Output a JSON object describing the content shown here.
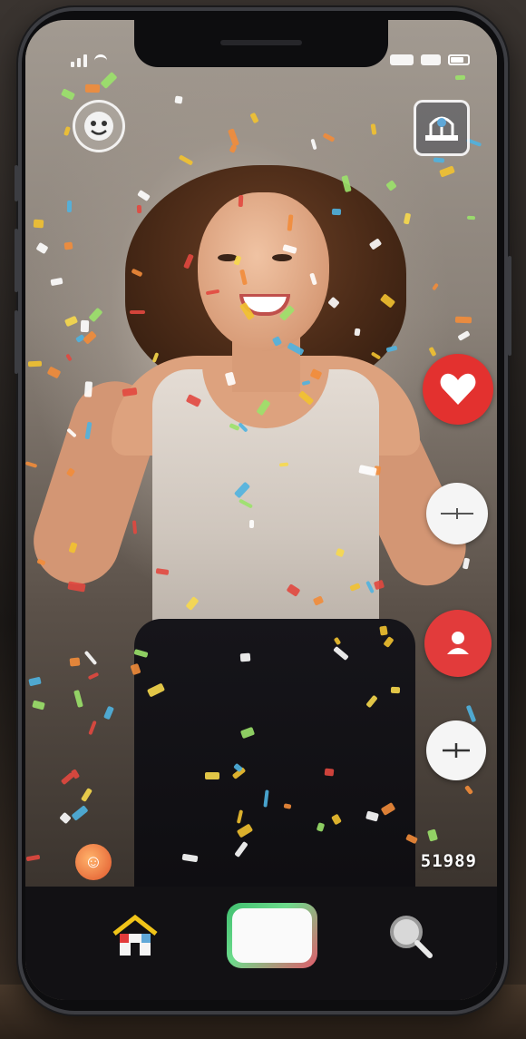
{
  "status_bar": {
    "signal_icon": "signal-icon",
    "wifi_icon": "wifi-icon",
    "battery_icon": "battery-icon"
  },
  "top_bar": {
    "left_icon": "face-filter-icon",
    "right_icon": "gallery-icon"
  },
  "actions": {
    "like_icon": "heart-icon",
    "share_icon": "share-icon",
    "profile_icon": "profile-icon",
    "more_icon": "more-icon"
  },
  "overlay": {
    "view_count": "51989"
  },
  "bottom_nav": {
    "home_icon": "home-icon",
    "record_icon": "record-icon",
    "search_icon": "search-icon"
  },
  "colors": {
    "like": "#e3312f",
    "profile": "#e23b3b",
    "record_gradient": [
      "#3fbf6f",
      "#e25a6b"
    ]
  }
}
